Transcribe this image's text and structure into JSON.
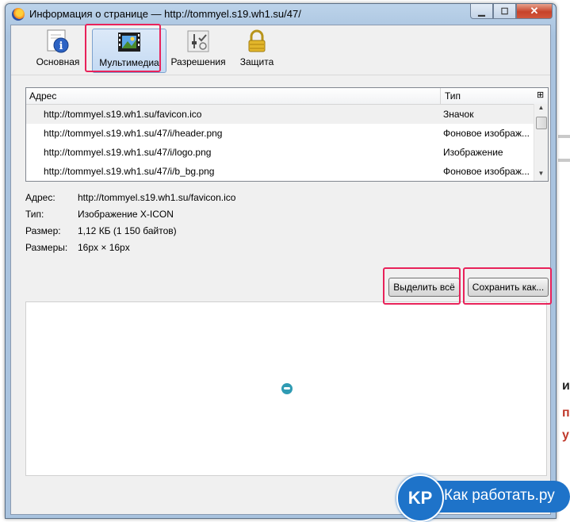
{
  "window": {
    "title": "Информация о странице — http://tommyel.s19.wh1.su/47/"
  },
  "toolbar": {
    "tabs": [
      {
        "label": "Основная",
        "icon": "info-icon"
      },
      {
        "label": "Мультимедиа",
        "icon": "media-icon"
      },
      {
        "label": "Разрешения",
        "icon": "permissions-icon"
      },
      {
        "label": "Защита",
        "icon": "lock-icon"
      }
    ]
  },
  "list": {
    "col_address": "Адрес",
    "col_type": "Тип",
    "rows": [
      {
        "url": "http://tommyel.s19.wh1.su/favicon.ico",
        "type": "Значок"
      },
      {
        "url": "http://tommyel.s19.wh1.su/47/i/header.png",
        "type": "Фоновое изображ..."
      },
      {
        "url": "http://tommyel.s19.wh1.su/47/i/logo.png",
        "type": "Изображение"
      },
      {
        "url": "http://tommyel.s19.wh1.su/47/i/b_bg.png",
        "type": "Фоновое изображ..."
      }
    ]
  },
  "details": {
    "address_label": "Адрес:",
    "address_value": "http://tommyel.s19.wh1.su/favicon.ico",
    "type_label": "Тип:",
    "type_value": "Изображение X-ICON",
    "size_label": "Размер:",
    "size_value": "1,12 КБ (1 150 байтов)",
    "dims_label": "Размеры:",
    "dims_value": "16px × 16px"
  },
  "buttons": {
    "select_all": "Выделить всё",
    "save_as": "Сохранить как..."
  },
  "watermark": {
    "logo": "KP",
    "text": "Как работать.ру"
  },
  "colors": {
    "highlight": "#e8225a",
    "brand": "#1e73c9"
  }
}
